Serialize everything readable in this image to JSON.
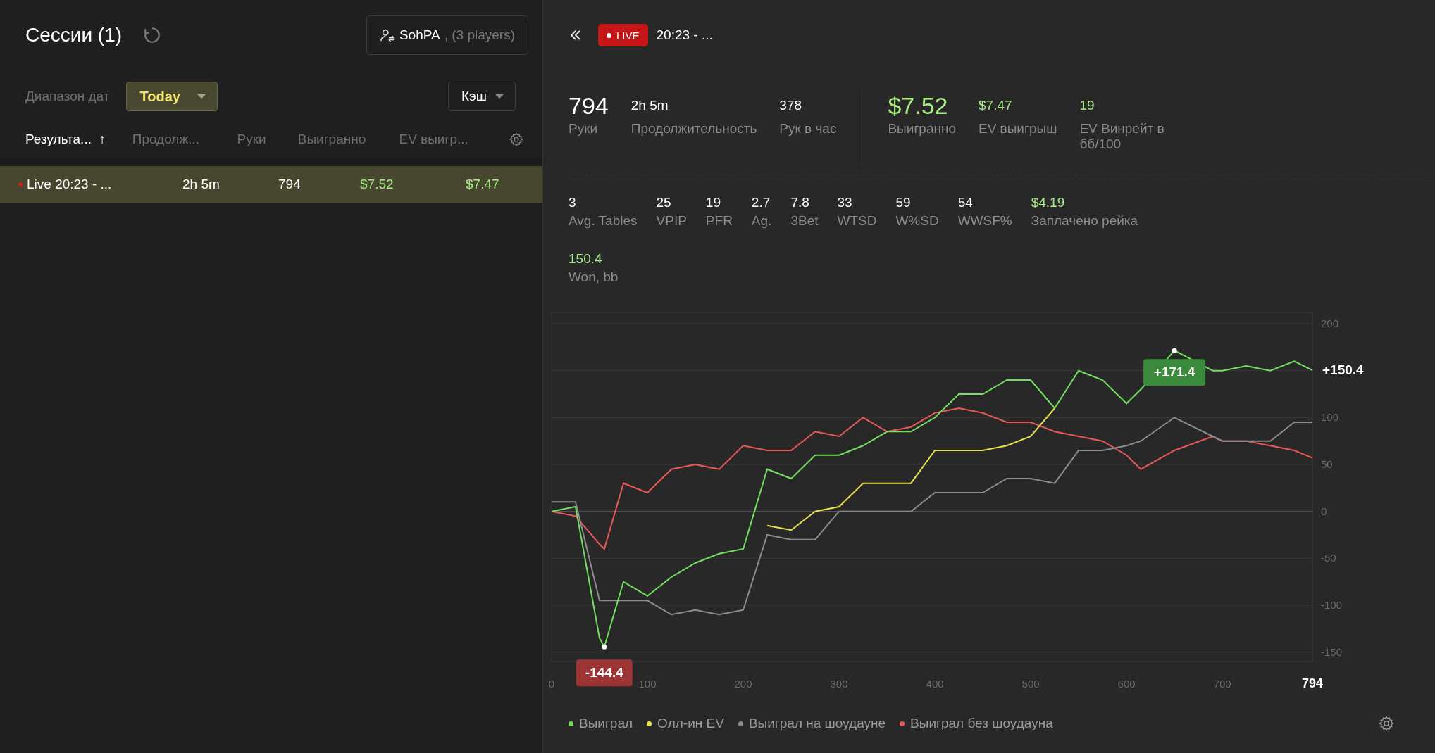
{
  "sessions_panel": {
    "title": "Сессии (1)",
    "player_filter": {
      "name": "SohPA",
      "suffix": ", (3 players)"
    },
    "date_range": {
      "label": "Диапазон дат",
      "value": "Today"
    },
    "game_type": {
      "value": "Кэш"
    },
    "table": {
      "columns": [
        {
          "label": "Результа...",
          "sort": "↑",
          "selected": true
        },
        {
          "label": "Продолж...",
          "selected": false
        },
        {
          "label": "Руки",
          "selected": false
        },
        {
          "label": "Выигранно",
          "selected": false
        },
        {
          "label": "EV выигр...",
          "selected": false
        }
      ],
      "rows": [
        {
          "selected": true,
          "live": true,
          "cells": [
            {
              "text": "Live 20:23 - ...",
              "kind": "text"
            },
            {
              "text": "2h 5m",
              "kind": "text"
            },
            {
              "text": "794",
              "kind": "text"
            },
            {
              "text": "$7.52",
              "kind": "money"
            },
            {
              "text": "$7.47",
              "kind": "money"
            }
          ]
        }
      ]
    }
  },
  "session_detail": {
    "live_badge": "LIVE",
    "title": "20:23 - ...",
    "summary_left": [
      {
        "value": "794",
        "label": "Руки",
        "large": true,
        "highlight": false
      },
      {
        "value": "2h 5m",
        "label": "Продолжительность",
        "large": false,
        "highlight": false
      },
      {
        "value": "378",
        "label": "Рук в час",
        "large": false,
        "highlight": false
      }
    ],
    "summary_right": [
      {
        "value": "$7.52",
        "label": "Выигранно",
        "large": true,
        "highlight": true
      },
      {
        "value": "$7.47",
        "label": "EV выигрыш",
        "large": false,
        "highlight": true
      },
      {
        "value": "19",
        "label": "EV Винрейт в бб/100",
        "large": false,
        "highlight": true
      }
    ],
    "stats": [
      {
        "value": "3",
        "label": "Avg. Tables",
        "highlight": false
      },
      {
        "value": "25",
        "label": "VPIP",
        "highlight": false
      },
      {
        "value": "19",
        "label": "PFR",
        "highlight": false
      },
      {
        "value": "2.7",
        "label": "Ag.",
        "highlight": false
      },
      {
        "value": "7.8",
        "label": "3Bet",
        "highlight": false
      },
      {
        "value": "33",
        "label": "WTSD",
        "highlight": false
      },
      {
        "value": "59",
        "label": "W%SD",
        "highlight": false
      },
      {
        "value": "54",
        "label": "WWSF%",
        "highlight": false
      },
      {
        "value": "$4.19",
        "label": "Заплачено рейка",
        "highlight": true
      }
    ],
    "won_bb": {
      "value": "150.4",
      "label": "Won, bb",
      "highlight": true
    },
    "chart_markers": [
      {
        "label": "+171.4",
        "kind": "max"
      },
      {
        "label": "-144.4",
        "kind": "min"
      },
      {
        "label": "+150.4",
        "kind": "end"
      }
    ],
    "chart_data": {
      "type": "line",
      "grid": true,
      "x": [
        0,
        25,
        50,
        55,
        75,
        100,
        125,
        150,
        175,
        200,
        225,
        250,
        275,
        300,
        325,
        350,
        375,
        400,
        425,
        450,
        475,
        500,
        525,
        550,
        575,
        600,
        615,
        650,
        690,
        700,
        725,
        750,
        775,
        794
      ],
      "series": [
        {
          "name": "Выиграл",
          "color": "#72e05e",
          "values": [
            0,
            5,
            -135,
            -144.4,
            -75,
            -90,
            -70,
            -55,
            -45,
            -40,
            45,
            35,
            60,
            60,
            70,
            85,
            85,
            100,
            125,
            125,
            140,
            140,
            110,
            150,
            140,
            115,
            130,
            171.4,
            150,
            150,
            155,
            150,
            160,
            150.4
          ]
        },
        {
          "name": "Олл-ин EV",
          "color": "#e6e04a",
          "values": [
            null,
            null,
            null,
            null,
            null,
            null,
            null,
            null,
            null,
            null,
            -15,
            -20,
            0,
            5,
            30,
            30,
            30,
            65,
            65,
            65,
            70,
            80,
            110,
            null,
            null,
            null,
            null,
            null,
            null,
            null,
            null,
            null,
            null,
            null
          ]
        },
        {
          "name": "Выиграл на шоудауне",
          "color": "#8c8c8c",
          "values": [
            10,
            10,
            -95,
            -95,
            -95,
            -95,
            -110,
            -105,
            -110,
            -105,
            -25,
            -30,
            -30,
            0,
            0,
            0,
            0,
            20,
            20,
            20,
            35,
            35,
            30,
            65,
            65,
            70,
            75,
            100,
            80,
            75,
            75,
            75,
            95,
            95
          ]
        },
        {
          "name": "Выиграл без шоудауна",
          "color": "#e85858",
          "values": [
            0,
            -5,
            -35,
            -40,
            30,
            20,
            45,
            50,
            45,
            70,
            65,
            65,
            85,
            80,
            100,
            85,
            90,
            105,
            110,
            105,
            95,
            95,
            85,
            80,
            75,
            60,
            45,
            65,
            80,
            75,
            75,
            70,
            65,
            57
          ]
        }
      ],
      "xlim": [
        0,
        794
      ],
      "ylim": [
        -160,
        212
      ],
      "xticks": [
        0,
        100,
        200,
        300,
        400,
        500,
        600,
        700,
        {
          "value": 794,
          "label": "794"
        }
      ],
      "yticks": [
        -150,
        -100,
        -50,
        0,
        50,
        100,
        200
      ]
    }
  }
}
